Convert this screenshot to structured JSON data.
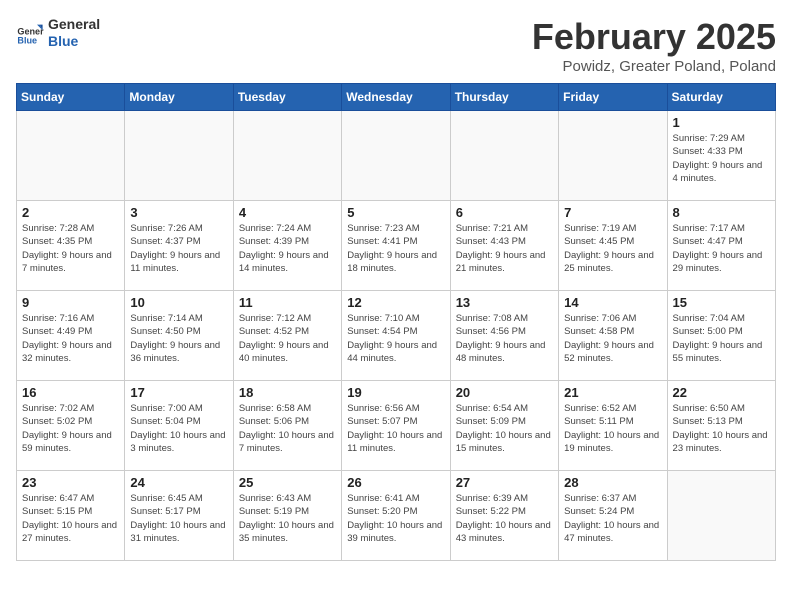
{
  "header": {
    "logo_line1": "General",
    "logo_line2": "Blue",
    "title": "February 2025",
    "subtitle": "Powidz, Greater Poland, Poland"
  },
  "weekdays": [
    "Sunday",
    "Monday",
    "Tuesday",
    "Wednesday",
    "Thursday",
    "Friday",
    "Saturday"
  ],
  "weeks": [
    [
      {
        "day": "",
        "info": ""
      },
      {
        "day": "",
        "info": ""
      },
      {
        "day": "",
        "info": ""
      },
      {
        "day": "",
        "info": ""
      },
      {
        "day": "",
        "info": ""
      },
      {
        "day": "",
        "info": ""
      },
      {
        "day": "1",
        "info": "Sunrise: 7:29 AM\nSunset: 4:33 PM\nDaylight: 9 hours and 4 minutes."
      }
    ],
    [
      {
        "day": "2",
        "info": "Sunrise: 7:28 AM\nSunset: 4:35 PM\nDaylight: 9 hours and 7 minutes."
      },
      {
        "day": "3",
        "info": "Sunrise: 7:26 AM\nSunset: 4:37 PM\nDaylight: 9 hours and 11 minutes."
      },
      {
        "day": "4",
        "info": "Sunrise: 7:24 AM\nSunset: 4:39 PM\nDaylight: 9 hours and 14 minutes."
      },
      {
        "day": "5",
        "info": "Sunrise: 7:23 AM\nSunset: 4:41 PM\nDaylight: 9 hours and 18 minutes."
      },
      {
        "day": "6",
        "info": "Sunrise: 7:21 AM\nSunset: 4:43 PM\nDaylight: 9 hours and 21 minutes."
      },
      {
        "day": "7",
        "info": "Sunrise: 7:19 AM\nSunset: 4:45 PM\nDaylight: 9 hours and 25 minutes."
      },
      {
        "day": "8",
        "info": "Sunrise: 7:17 AM\nSunset: 4:47 PM\nDaylight: 9 hours and 29 minutes."
      }
    ],
    [
      {
        "day": "9",
        "info": "Sunrise: 7:16 AM\nSunset: 4:49 PM\nDaylight: 9 hours and 32 minutes."
      },
      {
        "day": "10",
        "info": "Sunrise: 7:14 AM\nSunset: 4:50 PM\nDaylight: 9 hours and 36 minutes."
      },
      {
        "day": "11",
        "info": "Sunrise: 7:12 AM\nSunset: 4:52 PM\nDaylight: 9 hours and 40 minutes."
      },
      {
        "day": "12",
        "info": "Sunrise: 7:10 AM\nSunset: 4:54 PM\nDaylight: 9 hours and 44 minutes."
      },
      {
        "day": "13",
        "info": "Sunrise: 7:08 AM\nSunset: 4:56 PM\nDaylight: 9 hours and 48 minutes."
      },
      {
        "day": "14",
        "info": "Sunrise: 7:06 AM\nSunset: 4:58 PM\nDaylight: 9 hours and 52 minutes."
      },
      {
        "day": "15",
        "info": "Sunrise: 7:04 AM\nSunset: 5:00 PM\nDaylight: 9 hours and 55 minutes."
      }
    ],
    [
      {
        "day": "16",
        "info": "Sunrise: 7:02 AM\nSunset: 5:02 PM\nDaylight: 9 hours and 59 minutes."
      },
      {
        "day": "17",
        "info": "Sunrise: 7:00 AM\nSunset: 5:04 PM\nDaylight: 10 hours and 3 minutes."
      },
      {
        "day": "18",
        "info": "Sunrise: 6:58 AM\nSunset: 5:06 PM\nDaylight: 10 hours and 7 minutes."
      },
      {
        "day": "19",
        "info": "Sunrise: 6:56 AM\nSunset: 5:07 PM\nDaylight: 10 hours and 11 minutes."
      },
      {
        "day": "20",
        "info": "Sunrise: 6:54 AM\nSunset: 5:09 PM\nDaylight: 10 hours and 15 minutes."
      },
      {
        "day": "21",
        "info": "Sunrise: 6:52 AM\nSunset: 5:11 PM\nDaylight: 10 hours and 19 minutes."
      },
      {
        "day": "22",
        "info": "Sunrise: 6:50 AM\nSunset: 5:13 PM\nDaylight: 10 hours and 23 minutes."
      }
    ],
    [
      {
        "day": "23",
        "info": "Sunrise: 6:47 AM\nSunset: 5:15 PM\nDaylight: 10 hours and 27 minutes."
      },
      {
        "day": "24",
        "info": "Sunrise: 6:45 AM\nSunset: 5:17 PM\nDaylight: 10 hours and 31 minutes."
      },
      {
        "day": "25",
        "info": "Sunrise: 6:43 AM\nSunset: 5:19 PM\nDaylight: 10 hours and 35 minutes."
      },
      {
        "day": "26",
        "info": "Sunrise: 6:41 AM\nSunset: 5:20 PM\nDaylight: 10 hours and 39 minutes."
      },
      {
        "day": "27",
        "info": "Sunrise: 6:39 AM\nSunset: 5:22 PM\nDaylight: 10 hours and 43 minutes."
      },
      {
        "day": "28",
        "info": "Sunrise: 6:37 AM\nSunset: 5:24 PM\nDaylight: 10 hours and 47 minutes."
      },
      {
        "day": "",
        "info": ""
      }
    ]
  ]
}
